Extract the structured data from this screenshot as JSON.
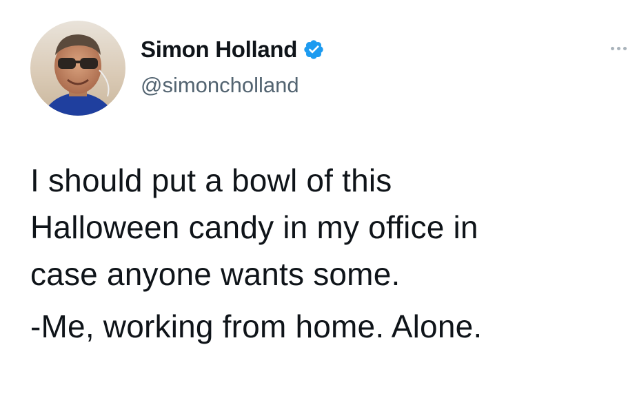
{
  "tweet": {
    "author": {
      "display_name": "Simon Holland",
      "handle": "@simoncholland",
      "verified": true,
      "avatar_icon": "profile-photo"
    },
    "more_icon": "more-icon",
    "body_lines": [
      "I should put a bowl of this",
      "Halloween candy in my office in",
      "case anyone wants some."
    ],
    "signoff": "-Me, working from home. Alone."
  },
  "colors": {
    "verified_badge": "#1d9bf0",
    "handle_gray": "#536471",
    "text": "#0f1419"
  }
}
